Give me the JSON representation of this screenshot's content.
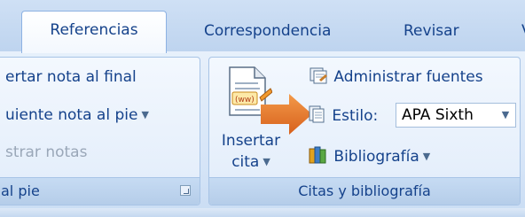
{
  "tabs": {
    "active": "Referencias",
    "t2": "Correspondencia",
    "t3": "Revisar",
    "t4": "V"
  },
  "footnotes_group": {
    "insert_endnote": "ertar nota al final",
    "next_footnote": "uiente nota al pie",
    "show_notes": "strar notas",
    "footer": "al pie"
  },
  "citations_group": {
    "insert_citation_line1": "Insertar",
    "insert_citation_line2": "cita",
    "manage_sources": "Administrar fuentes",
    "style_label": "Estilo:",
    "style_value": "APA Sixth",
    "bibliography": "Bibliografía",
    "footer": "Citas y bibliografía"
  },
  "colors": {
    "accent": "#15428b",
    "arrow": "#e8731c"
  }
}
